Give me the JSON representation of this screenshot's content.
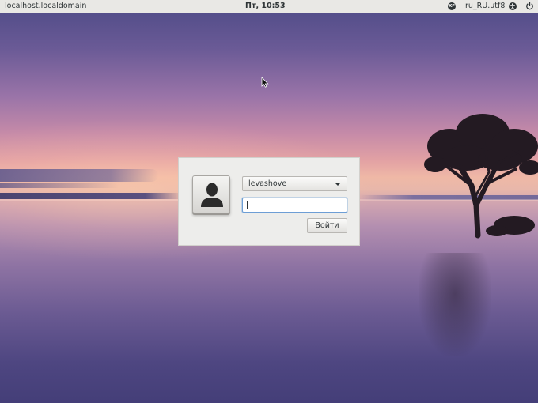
{
  "topbar": {
    "hostname": "localhost.localdomain",
    "clock": "Пт, 10:53",
    "xf_icon_text": "XF",
    "locale": "ru_RU.utf8",
    "icons": [
      "xf-keyboard-icon",
      "accessibility-icon",
      "power-icon"
    ]
  },
  "login": {
    "username": "levashove",
    "password_value": "",
    "login_button_label": "Войти"
  },
  "colors": {
    "topbar_bg": "#e9e8e5",
    "dialog_bg": "#ededeb",
    "focus_border": "#6d9ed5"
  }
}
